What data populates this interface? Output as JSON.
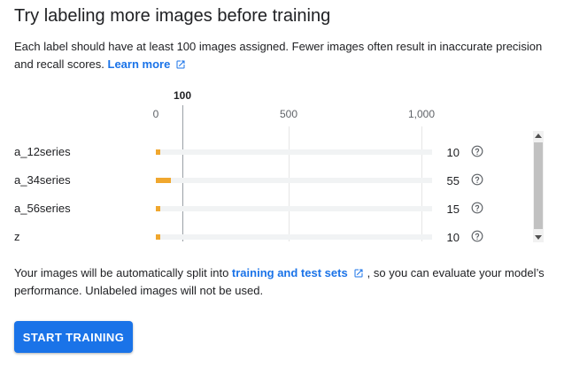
{
  "title": "Try labeling more images before training",
  "description": {
    "text": "Each label should have at least 100 images assigned. Fewer images often result in inaccurate precision and recall scores. ",
    "link": "Learn more",
    "icon": "open-in-new-icon"
  },
  "chart_data": {
    "type": "bar",
    "threshold": 100,
    "threshold_label": "100",
    "xlim": [
      0,
      1000
    ],
    "ticks": [
      {
        "value": 0,
        "label": "0"
      },
      {
        "value": 500,
        "label": "500"
      },
      {
        "value": 1000,
        "label": "1,000"
      }
    ],
    "categories": [
      "a_12series",
      "a_34series",
      "a_56series",
      "z"
    ],
    "values": [
      10,
      55,
      15,
      10
    ],
    "value_labels": [
      "10",
      "55",
      "15",
      "10"
    ],
    "bar_color": "#f0a72e"
  },
  "split_text": {
    "before": "Your images will be automatically split into ",
    "link": "training and test sets",
    "after": ", so you can evaluate your model’s performance. Unlabeled images will not be used.",
    "icon": "open-in-new-icon"
  },
  "button": {
    "label": "START TRAINING",
    "color": "#1a73e8"
  }
}
